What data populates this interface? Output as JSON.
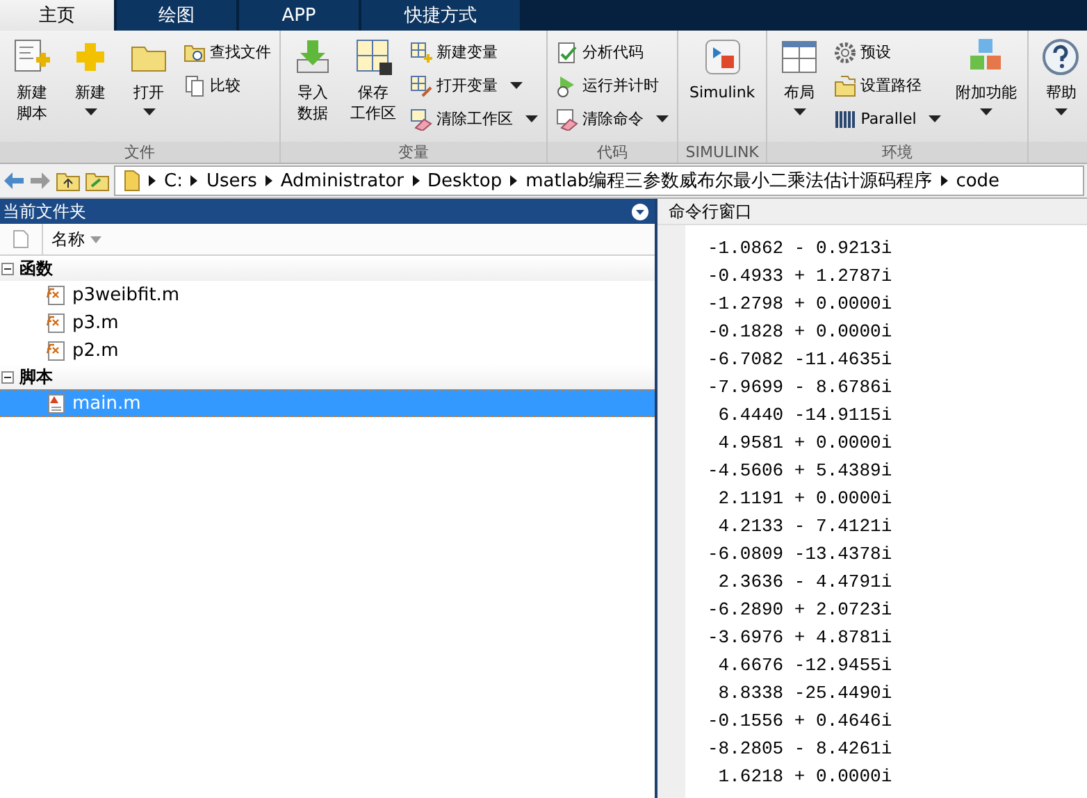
{
  "tabs": [
    {
      "label": "主页",
      "selected": true
    },
    {
      "label": "绘图",
      "selected": false
    },
    {
      "label": "APP",
      "selected": false
    },
    {
      "label": "快捷方式",
      "selected": false
    }
  ],
  "ribbon": {
    "groups": [
      {
        "label": "文件",
        "items": [
          {
            "kind": "large",
            "lines": [
              "新建",
              "脚本"
            ],
            "dropdown": false
          },
          {
            "kind": "large",
            "lines": [
              "新建"
            ],
            "dropdown": true
          },
          {
            "kind": "large",
            "lines": [
              "打开"
            ],
            "dropdown": true
          },
          {
            "kind": "stack",
            "items": [
              {
                "label": "查找文件",
                "dropdown": false
              },
              {
                "label": "比较",
                "dropdown": false
              }
            ]
          }
        ]
      },
      {
        "label": "变量",
        "items": [
          {
            "kind": "large",
            "lines": [
              "导入",
              "数据"
            ],
            "dropdown": false
          },
          {
            "kind": "large",
            "lines": [
              "保存",
              "工作区"
            ],
            "dropdown": false
          },
          {
            "kind": "stack",
            "items": [
              {
                "label": "新建变量",
                "dropdown": false
              },
              {
                "label": "打开变量",
                "dropdown": true
              },
              {
                "label": "清除工作区",
                "dropdown": true
              }
            ]
          }
        ]
      },
      {
        "label": "代码",
        "items": [
          {
            "kind": "stack",
            "items": [
              {
                "label": "分析代码",
                "dropdown": false
              },
              {
                "label": "运行并计时",
                "dropdown": false
              },
              {
                "label": "清除命令",
                "dropdown": true
              }
            ]
          }
        ]
      },
      {
        "label": "SIMULINK",
        "items": [
          {
            "kind": "large",
            "lines": [
              "Simulink"
            ],
            "dropdown": false
          }
        ]
      },
      {
        "label": "环境",
        "items": [
          {
            "kind": "large",
            "lines": [
              "布局"
            ],
            "dropdown": true
          },
          {
            "kind": "stack",
            "items": [
              {
                "label": "预设",
                "dropdown": false
              },
              {
                "label": "设置路径",
                "dropdown": false
              },
              {
                "label": "Parallel",
                "dropdown": true
              }
            ]
          },
          {
            "kind": "large",
            "lines": [
              "附加功能"
            ],
            "dropdown": true
          }
        ]
      },
      {
        "items": [
          {
            "kind": "large",
            "lines": [
              "帮助"
            ],
            "dropdown": true
          }
        ]
      }
    ]
  },
  "address": {
    "crumbs": [
      "C:",
      "Users",
      "Administrator",
      "Desktop",
      "matlab编程三参数威布尔最小二乘法估计源码程序",
      "code"
    ]
  },
  "folder_panel": {
    "title": "当前文件夹",
    "column": "名称",
    "groups": [
      {
        "label": "函数",
        "expanded": true,
        "children": [
          {
            "name": "p3weibfit.m",
            "kind": "function",
            "selected": false
          },
          {
            "name": "p3.m",
            "kind": "function",
            "selected": false
          },
          {
            "name": "p2.m",
            "kind": "function",
            "selected": false
          }
        ]
      },
      {
        "label": "脚本",
        "expanded": true,
        "children": [
          {
            "name": "main.m",
            "kind": "script",
            "selected": true
          }
        ]
      }
    ]
  },
  "command_window": {
    "title": "命令行窗口",
    "lines": [
      "-1.0862 - 0.9213i",
      "-0.4933 + 1.2787i",
      "-1.2798 + 0.0000i",
      "-0.1828 + 0.0000i",
      "-6.7082 -11.4635i",
      "-7.9699 - 8.6786i",
      " 6.4440 -14.9115i",
      " 4.9581 + 0.0000i",
      "-4.5606 + 5.4389i",
      " 2.1191 + 0.0000i",
      " 4.2133 - 7.4121i",
      "-6.0809 -13.4378i",
      " 2.3636 - 4.4791i",
      "-6.2890 + 2.0723i",
      "-3.6976 + 4.8781i",
      " 4.6676 -12.9455i",
      " 8.8338 -25.4490i",
      "-0.1556 + 0.4646i",
      "-8.2805 - 8.4261i",
      " 1.6218 + 0.0000i"
    ]
  }
}
